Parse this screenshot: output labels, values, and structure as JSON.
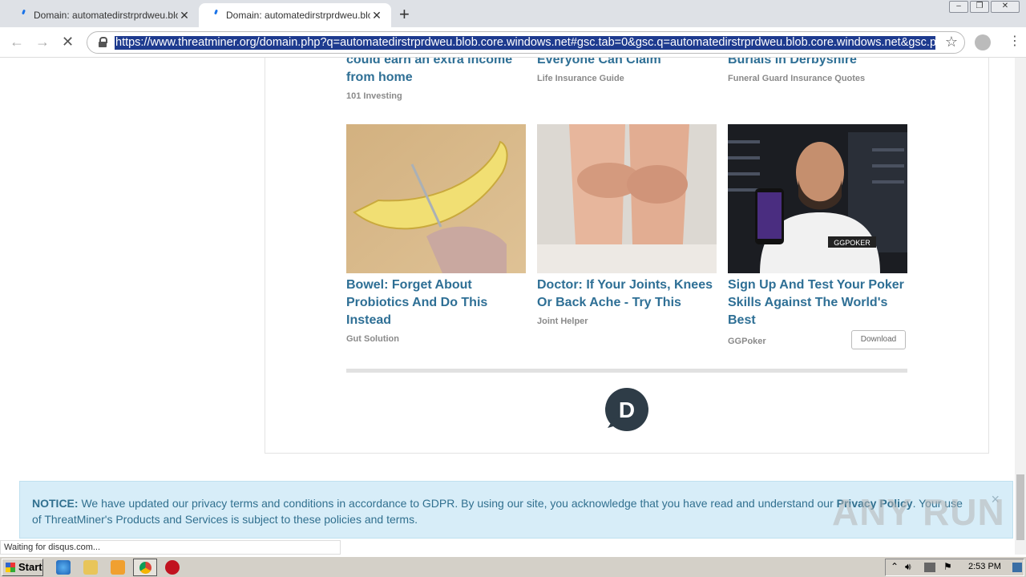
{
  "browser": {
    "tabs": [
      {
        "title": "Domain: automatedirstrprdweu.blob.core.windows.net",
        "active": false
      },
      {
        "title": "Domain: automatedirstrprdweu.blob.core.windows.net",
        "active": true
      }
    ],
    "url": "https://www.threatminer.org/domain.php?q=automatedirstrprdweu.blob.core.windows.net#gsc.tab=0&gsc.q=automatedirstrprdweu.blob.core.windows.net&gsc.page",
    "status_text": "Waiting for disqus.com..."
  },
  "ads_row1": [
    {
      "title": "could earn an extra income from home",
      "source": "101 Investing"
    },
    {
      "title": "Everyone Can Claim",
      "source": "Life Insurance Guide"
    },
    {
      "title": "Burials in Derbyshire",
      "source": "Funeral Guard Insurance Quotes"
    }
  ],
  "ads_row2": [
    {
      "title": "Bowel: Forget About Probiotics And Do This Instead",
      "source": "Gut Solution",
      "image": "banana-knife-photo"
    },
    {
      "title": "Doctor: If Your Joints, Knees Or Back Ache - Try This",
      "source": "Joint Helper",
      "image": "knees-photo"
    },
    {
      "title": "Sign Up And Test Your Poker Skills Against The World's Best",
      "source": "GGPoker",
      "image": "poker-player-photo",
      "button": "Download"
    }
  ],
  "disqus_logo_letter": "D",
  "phone_brand": "GGPOKER",
  "notice": {
    "label": "NOTICE:",
    "text_before": " We have updated our privacy terms and conditions in accordance to GDPR. By using our site, you acknowledge that you have read and understand our ",
    "link": "Privacy Policy",
    "text_after": ". Your use of ThreatMiner's Products and Services is subject to these policies and terms.",
    "close": "×"
  },
  "watermark": "ANY RUN",
  "taskbar": {
    "start": "Start",
    "clock": "2:53 PM"
  },
  "colors": {
    "link": "#2e6f95",
    "notice_bg": "#d7edf8",
    "url_highlight": "#1e3b8f"
  }
}
